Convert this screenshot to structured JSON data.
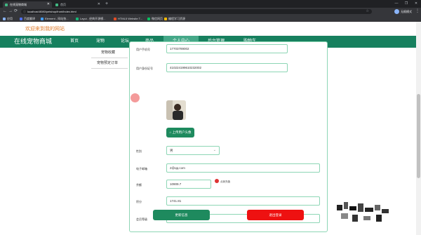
{
  "browser": {
    "tabs": [
      {
        "title": "在线宠物商城",
        "active": true
      },
      {
        "title": "首页",
        "active": false
      }
    ],
    "new_tab": "+",
    "window_controls": [
      "—",
      "❐",
      "✕"
    ],
    "url": "localhost:8080/petshop/front/index.html",
    "profile_name": "无痕模式",
    "bookmarks": [
      {
        "label": "应用",
        "color": "#8ab4f8"
      },
      {
        "label": "百度翻译",
        "color": "#4e6ef2"
      },
      {
        "label": "Element - 网站快...",
        "color": "#409eff"
      },
      {
        "label": "Layui - 经典开源模...",
        "color": "#16b777"
      },
      {
        "label": "HTML5 Website T...",
        "color": "#e44d26"
      },
      {
        "label": "微信网页",
        "color": "#07c160"
      },
      {
        "label": "编程学习资源",
        "color": "#fbbc04"
      }
    ]
  },
  "page": {
    "welcome": "欢迎来到我的网站",
    "brand": "在线宠物商城",
    "nav": [
      {
        "label": "首页",
        "active": false
      },
      {
        "label": "宠物",
        "active": false
      },
      {
        "label": "论坛",
        "active": false
      },
      {
        "label": "商品",
        "active": false
      },
      {
        "label": "个人中心",
        "active": true
      },
      {
        "label": "后台管理",
        "active": false
      },
      {
        "label": "购物车",
        "active": false
      }
    ],
    "side_menu": [
      "宠物收藏",
      "宠物预定订单"
    ],
    "form": {
      "phone_label": "用户手机号",
      "phone_value": "17703789002",
      "idcard_label": "用户身份证号",
      "idcard_value": "410224199610232002",
      "upload_button": "上传用户头像",
      "gender_label": "性别",
      "gender_value": "男",
      "email_label": "电子邮箱",
      "email_value": "2@qq.com",
      "balance_label": "余额",
      "balance_value": "10909.7",
      "recharge_label": "点我充值",
      "points_label": "积分",
      "points_value": "1741.81",
      "level_label": "会员等级",
      "level_value": "钻石会员",
      "update_button": "更新信息",
      "logout_button": "退出登录"
    },
    "colors": {
      "nav_bg": "#16805e",
      "nav_active": "#45a888",
      "field_border": "#8dd6b5",
      "update_button": "#1e8a5e",
      "logout_button": "#ee1111",
      "welcome": "#e07b2a"
    }
  }
}
